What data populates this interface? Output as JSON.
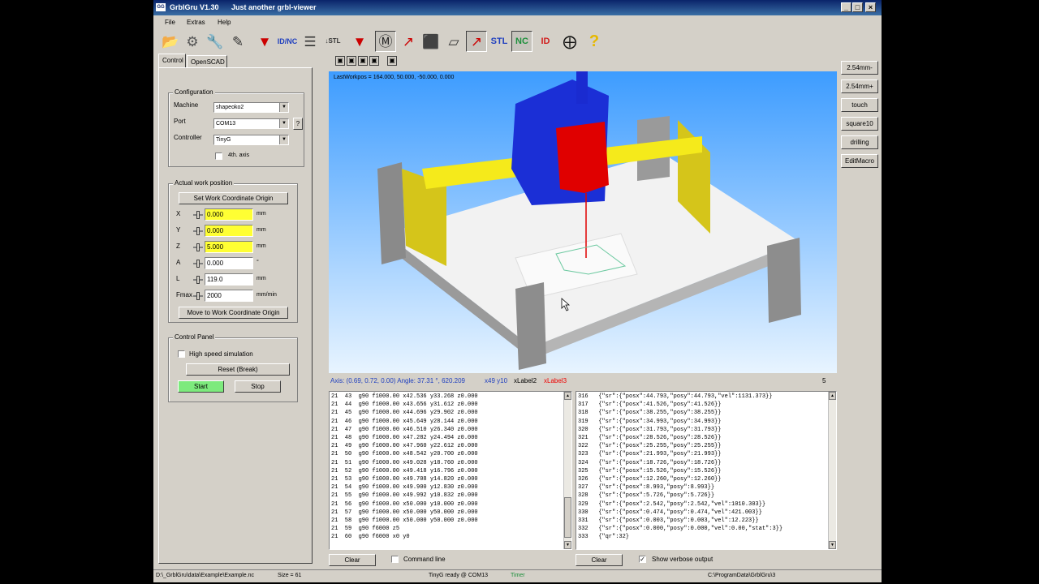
{
  "window": {
    "title": "GrblGru V1.30",
    "subtitle": "Just another grbl-viewer"
  },
  "menu": [
    "File",
    "Extras",
    "Help"
  ],
  "toolbar": {
    "icons": [
      "folder-open-icon",
      "gear-icon",
      "wrench-icon",
      "edit-icon",
      "probe-icon",
      "id-nc-icon",
      "layers-icon",
      "stl-arrow-icon",
      "tool-icon",
      "machine-icon",
      "axis-icon",
      "cube-icon",
      "plane-icon",
      "view-icon"
    ],
    "text_buttons": [
      {
        "label": "STL",
        "color": "#1f3fbf"
      },
      {
        "label": "NC",
        "color": "#1c8f3b"
      },
      {
        "label": "ID",
        "color": "#d11d1d"
      }
    ],
    "help_icon": "?"
  },
  "tabs": [
    {
      "label": "Control"
    },
    {
      "label": "OpenSCAD"
    }
  ],
  "config": {
    "title": "Configuration",
    "machine_label": "Machine",
    "machine_value": "shapeoko2",
    "port_label": "Port",
    "port_value": "COM13",
    "help": "?",
    "controller_label": "Controller",
    "controller_value": "TinyG",
    "axis4_label": "4th. axis"
  },
  "workpos": {
    "title": "Actual work position",
    "set_button": "Set Work Coordinate Origin",
    "rows": [
      {
        "axis": "X",
        "value": "0.000",
        "unit": "mm",
        "highlight": true
      },
      {
        "axis": "Y",
        "value": "0.000",
        "unit": "mm",
        "highlight": true
      },
      {
        "axis": "Z",
        "value": "5.000",
        "unit": "mm",
        "highlight": true
      },
      {
        "axis": "A",
        "value": "0.000",
        "unit": "°",
        "highlight": false
      },
      {
        "axis": "L",
        "value": "119.0",
        "unit": "mm",
        "highlight": false
      },
      {
        "axis": "Fmax",
        "value": "2000",
        "unit": "mm/min",
        "highlight": false
      }
    ],
    "move_button": "Move to Work Coordinate Origin"
  },
  "control": {
    "title": "Control Panel",
    "highspeed_label": "High speed simulation",
    "reset_button": "Reset (Break)",
    "start_button": "Start",
    "stop_button": "Stop"
  },
  "viewport": {
    "last_text": "LastWorkpos = 164.000, 50.000, -50.000, 0.000"
  },
  "status_line": {
    "angles": "Axis: (0.69, 0.72, 0.00) Angle: 37.31 °, 620.209",
    "pos": "x49 y10",
    "label2": "xLabel2",
    "label3": "xLabel3",
    "count": "5"
  },
  "gcode_lines": [
    "21  43  g90 f1000.00 x42.536 y33.268 z0.000",
    "21  44  g90 f1000.00 x43.656 y31.612 z0.000",
    "21  45  g90 f1000.00 x44.696 y29.902 z0.000",
    "21  46  g90 f1000.00 x45.649 y28.144 z0.000",
    "21  47  g90 f1000.00 x46.510 y26.340 z0.000",
    "21  48  g90 f1000.00 x47.282 y24.494 z0.000",
    "21  49  g90 f1000.00 x47.960 y22.612 z0.000",
    "21  50  g90 f1000.00 x48.542 y20.700 z0.000",
    "21  51  g90 f1000.00 x49.028 y18.760 z0.000",
    "21  52  g90 f1000.00 x49.418 y16.796 z0.000",
    "21  53  g90 f1000.00 x49.708 y14.820 z0.000",
    "21  54  g90 f1000.00 x49.900 y12.830 z0.000",
    "21  55  g90 f1000.00 x49.992 y10.832 z0.000",
    "21  56  g90 f1000.00 x50.000 y10.000 z0.000",
    "21  57  g90 f1000.00 x50.000 y50.000 z0.000",
    "21  58  g90 f1000.00 x50.000 y50.000 z0.000",
    "21  59  g90 f6000 z5",
    "21  60  g90 f6000 x0 y0"
  ],
  "response_lines": [
    "316   {\"sr\":{\"posx\":44.793,\"posy\":44.793,\"vel\":1131.373}}",
    "317   {\"sr\":{\"posx\":41.526,\"posy\":41.526}}",
    "318   {\"sr\":{\"posx\":38.255,\"posy\":38.255}}",
    "319   {\"sr\":{\"posx\":34.993,\"posy\":34.993}}",
    "320   {\"sr\":{\"posx\":31.793,\"posy\":31.793}}",
    "321   {\"sr\":{\"posx\":28.526,\"posy\":28.526}}",
    "322   {\"sr\":{\"posx\":25.255,\"posy\":25.255}}",
    "323   {\"sr\":{\"posx\":21.993,\"posy\":21.993}}",
    "324   {\"sr\":{\"posx\":18.726,\"posy\":18.726}}",
    "325   {\"sr\":{\"posx\":15.526,\"posy\":15.526}}",
    "326   {\"sr\":{\"posx\":12.260,\"posy\":12.260}}",
    "327   {\"sr\":{\"posx\":8.993,\"posy\":8.993}}",
    "328   {\"sr\":{\"posx\":5.726,\"posy\":5.726}}",
    "329   {\"sr\":{\"posx\":2.542,\"posy\":2.542,\"vel\":1010.303}}",
    "330   {\"sr\":{\"posx\":0.474,\"posy\":0.474,\"vel\":421.003}}",
    "331   {\"sr\":{\"posx\":0.003,\"posy\":0.003,\"vel\":12.223}}",
    "332   {\"sr\":{\"posx\":0.000,\"posy\":0.000,\"vel\":0.00,\"stat\":3}}",
    "333   {\"qr\":32}"
  ],
  "bottom": {
    "clear1": "Clear",
    "command_line_label": "Command line",
    "clear2": "Clear",
    "verbose_label": "Show verbose output"
  },
  "macros": [
    "2.54mm-",
    "2.54mm+",
    "touch",
    "square10",
    "drilling",
    "EditMacro"
  ],
  "statusbar": {
    "file": "D:\\_GrblGru\\data\\Example\\Example.nc",
    "size": "Size = 61",
    "status": "TinyG ready @ COM13",
    "timer": "Timer",
    "path": "C:\\ProgramData\\GrblGru\\3"
  },
  "colors": {
    "highlight_field": "#ffff33",
    "start_button": "#7dea7d",
    "viewport_top": "#3d9cff"
  }
}
